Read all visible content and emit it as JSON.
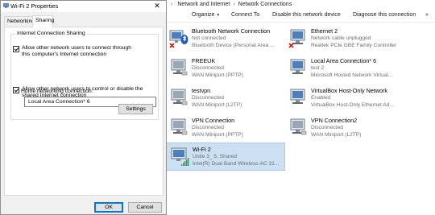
{
  "explorer": {
    "breadcrumb": [
      "Network and Internet",
      "Network Connections"
    ],
    "toolbar": {
      "organize": "Organize",
      "connect_to": "Connect To",
      "disable": "Disable this network device",
      "diagnose": "Diagnose this connection"
    },
    "connections": [
      {
        "name": "Bluetooth Network Connection",
        "status": "Not connected",
        "device": "Bluetooth Device (Personal Area ...",
        "icon": "bluetooth-adapter-icon",
        "state": "error"
      },
      {
        "name": "Ethernet 2",
        "status": "Network cable unplugged",
        "device": "Realtek PCIe GBE Family Controller",
        "icon": "ethernet-adapter-icon",
        "state": "error"
      },
      {
        "name": "FREEUK",
        "status": "Disconnected",
        "device": "WAN Miniport (PPTP)",
        "icon": "vpn-adapter-icon",
        "state": "off"
      },
      {
        "name": "Local Area Connection* 6",
        "status": "test  2",
        "device": "Microsoft Hosted Network Virtual...",
        "icon": "network-adapter-icon",
        "state": "ok"
      },
      {
        "name": "testvpn",
        "status": "Disconnected",
        "device": "WAN Miniport (L2TP)",
        "icon": "vpn-adapter-icon",
        "state": "off"
      },
      {
        "name": "VirtualBox Host-Only Network",
        "status": "Enabled",
        "device": "VirtualBox Host-Only Ethernet Ad...",
        "icon": "network-adapter-icon",
        "state": "ok"
      },
      {
        "name": "VPN Connection",
        "status": "Disconnected",
        "device": "WAN Miniport (PPTP)",
        "icon": "vpn-adapter-icon",
        "state": "off"
      },
      {
        "name": "VPN Connection2",
        "status": "Disconnected",
        "device": "WAN Miniport (L2TP)",
        "icon": "vpn-adapter-icon",
        "state": "off"
      },
      {
        "name": "Wi-Fi 2",
        "status": "Unite 3_ 5, Shared",
        "device": "Intel(R) Dual Band Wireless-AC 31...",
        "icon": "wifi-adapter-icon",
        "state": "wifi"
      }
    ]
  },
  "dialog": {
    "title": "Wi-Fi 2 Properties",
    "tabs": [
      "Networking",
      "Sharing"
    ],
    "active_tab": "Sharing",
    "group_label": "Internet Connection Sharing",
    "allow_connect_label": "Allow other network users to connect through this computer's Internet connection",
    "home_network_label": "Home networking connection:",
    "home_network_value": "Local Area Connection* 6",
    "allow_control_label": "Allow other network users to control or disable the shared Internet connection",
    "settings_button": "Settings",
    "ok_button": "OK",
    "cancel_button": "Cancel"
  },
  "colors": {
    "selection": "#cce0f3",
    "accent": "#0078d7",
    "error": "#d0201a",
    "signal": "#2aa23a"
  }
}
